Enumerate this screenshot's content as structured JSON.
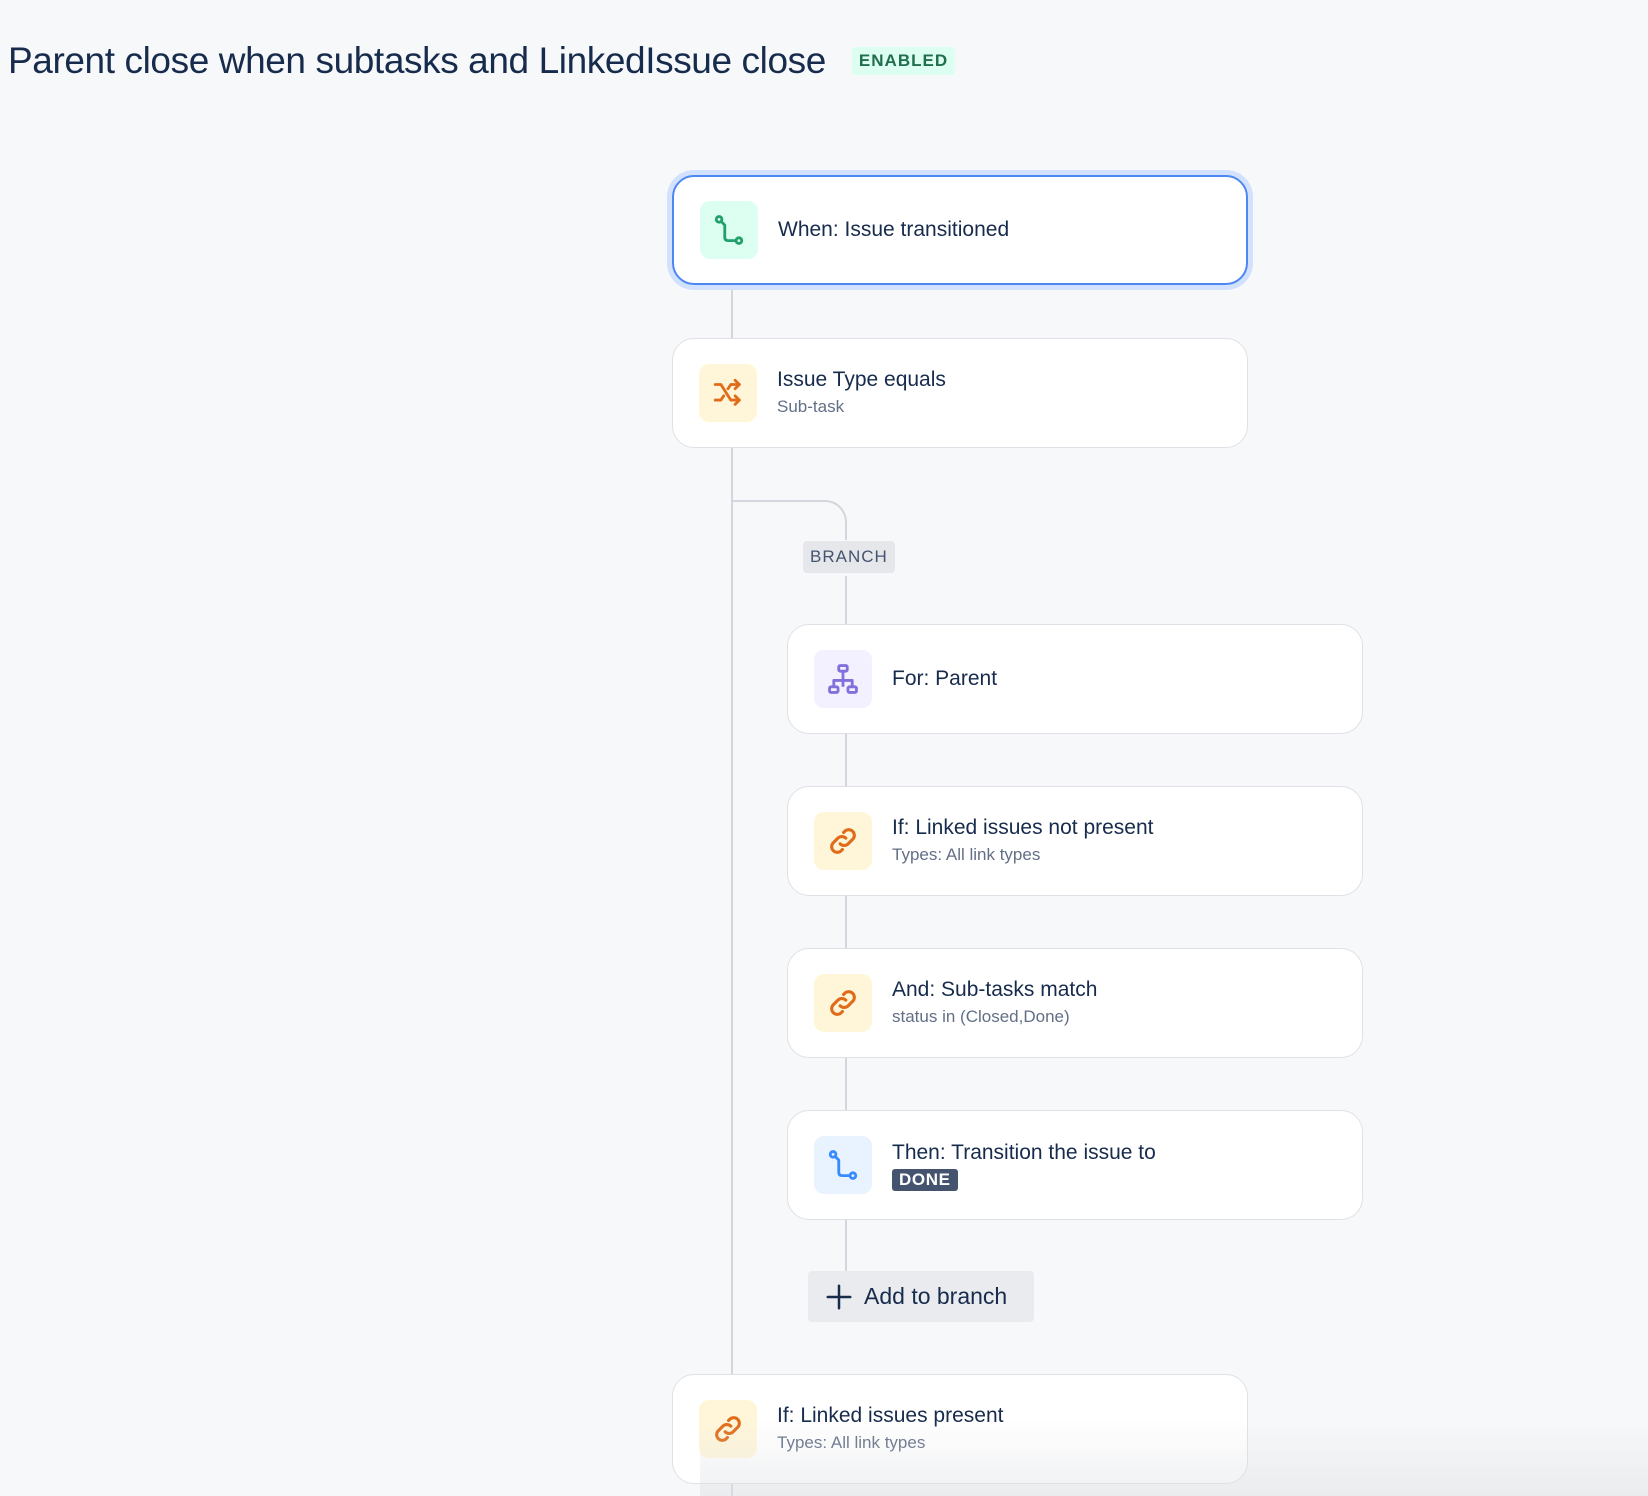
{
  "header": {
    "title": "Parent close when subtasks and LinkedIssue close",
    "status": "ENABLED"
  },
  "flow": {
    "trigger": {
      "title": "When: Issue transitioned",
      "icon": "transition-icon"
    },
    "condition": {
      "title": "Issue Type equals",
      "subtitle": "Sub-task",
      "icon": "shuffle-icon"
    },
    "branch": {
      "label": "BRANCH",
      "for": {
        "title": "For: Parent",
        "icon": "hierarchy-icon"
      },
      "if": {
        "title": "If: Linked issues not present",
        "subtitle": "Types: All link types",
        "icon": "link-icon"
      },
      "and": {
        "title": "And: Sub-tasks match",
        "subtitle": "status in (Closed,Done)",
        "icon": "link-icon"
      },
      "then": {
        "title": "Then: Transition the issue to",
        "status": "DONE",
        "icon": "transition-icon"
      },
      "add_label": "Add to branch"
    },
    "after": {
      "title": "If: Linked issues present",
      "subtitle": "Types: All link types",
      "icon": "link-icon"
    }
  },
  "colors": {
    "accent": "#4c87f4",
    "enabled_badge_bg": "#dcfff1",
    "enabled_badge_text": "#216e4e",
    "done_lozenge": "#44546f"
  }
}
